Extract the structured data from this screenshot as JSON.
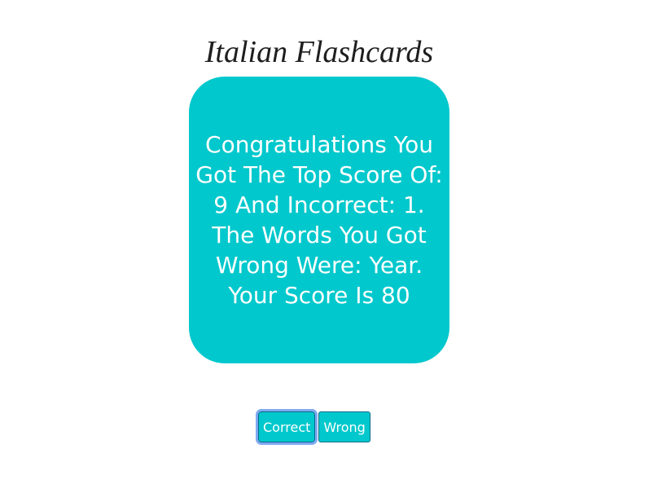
{
  "page": {
    "title": "Italian Flashcards"
  },
  "card": {
    "message": "Congratulations You Got The Top Score Of: 9 And Incorrect: 1. The Words You Got Wrong Were: Year. Your Score Is 80",
    "background_color": "#00c8cc"
  },
  "buttons": {
    "correct_label": "Correct",
    "wrong_label": "Wrong"
  }
}
